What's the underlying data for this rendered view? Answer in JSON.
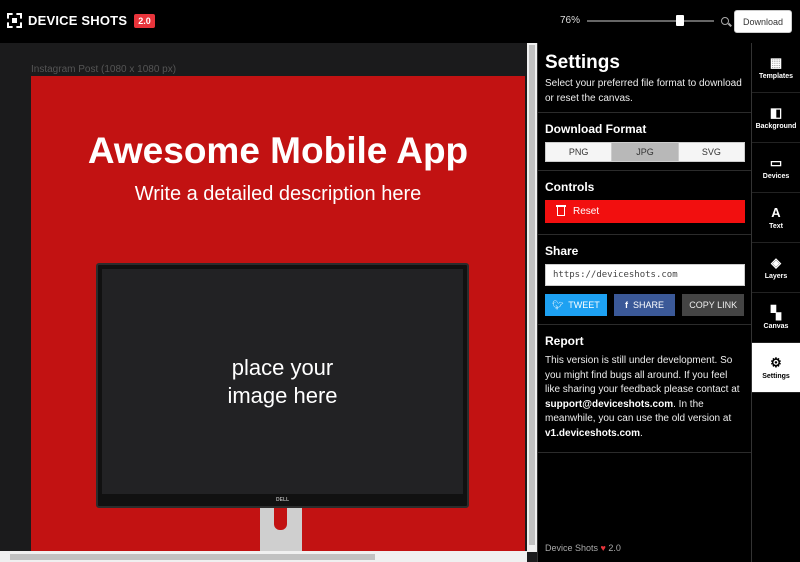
{
  "app": {
    "name": "DEVICE SHOTS",
    "version_badge": "2.0",
    "zoom": "76%",
    "zoom_fraction": 0.76,
    "download_label": "Download"
  },
  "canvas": {
    "label": "Instagram Post (1080 x 1080 px)",
    "headline": "Awesome Mobile App",
    "subline": "Write a detailed description here",
    "placeholder": "place your\nimage here",
    "device_brand": "DELL",
    "background_color": "#c21212"
  },
  "settings": {
    "title": "Settings",
    "description": "Select your preferred file format to download or reset the canvas.",
    "download_format_title": "Download Format",
    "formats": [
      "PNG",
      "JPG",
      "SVG"
    ],
    "selected_format": "JPG",
    "controls_title": "Controls",
    "reset_label": "Reset",
    "share_title": "Share",
    "share_url": "https://deviceshots.com",
    "tweet_label": "TWEET",
    "share_label": "SHARE",
    "copy_label": "COPY LINK",
    "report_title": "Report",
    "report_intro": "This version is still under development. So you might find bugs all around. If you feel like sharing your feedback please contact at ",
    "report_email": "support@deviceshots.com",
    "report_mid": ". In the meanwhile, you can use the old version at ",
    "report_old_url": "v1.deviceshots.com",
    "report_end": ".",
    "footer_name": "Device Shots",
    "footer_heart": "♥",
    "footer_version": "2.0"
  },
  "sidenav": {
    "items": [
      {
        "label": "Templates",
        "icon": "templates-icon",
        "glyph": "▦"
      },
      {
        "label": "Background",
        "icon": "background-icon",
        "glyph": "◧"
      },
      {
        "label": "Devices",
        "icon": "devices-icon",
        "glyph": "▭"
      },
      {
        "label": "Text",
        "icon": "text-icon",
        "glyph": "A"
      },
      {
        "label": "Layers",
        "icon": "layers-icon",
        "glyph": "◈"
      },
      {
        "label": "Canvas",
        "icon": "canvas-icon",
        "glyph": "▚"
      },
      {
        "label": "Settings",
        "icon": "settings-icon",
        "glyph": "⚙"
      }
    ],
    "active": "Settings"
  }
}
